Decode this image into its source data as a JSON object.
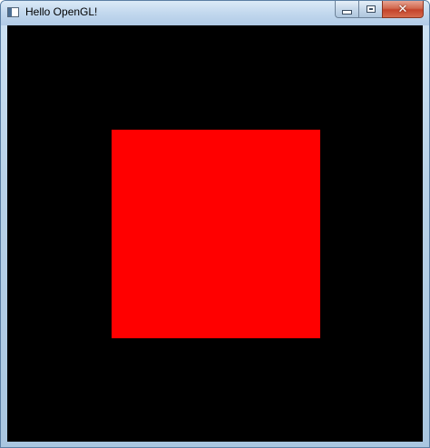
{
  "window": {
    "title": "Hello OpenGL!",
    "icon": "app-window-icon",
    "buttons": {
      "minimize_icon": "minimize-icon",
      "maximize_icon": "maximize-icon",
      "close_label": "✕"
    }
  },
  "canvas": {
    "background_color": "#000000",
    "shape": {
      "type": "square",
      "color": "#ff0000"
    }
  }
}
